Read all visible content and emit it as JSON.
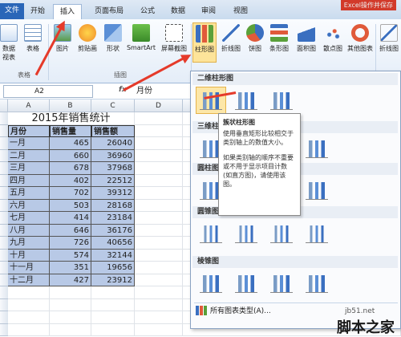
{
  "tabs": [
    {
      "label": "文件"
    },
    {
      "label": "开始"
    },
    {
      "label": "插入"
    },
    {
      "label": "页面布局"
    },
    {
      "label": "公式"
    },
    {
      "label": "数据"
    },
    {
      "label": "审阅"
    },
    {
      "label": "视图"
    }
  ],
  "title_fragment": "Excel操作并保存",
  "ribbon": {
    "groups": {
      "tables": "表格",
      "illustrations": "插图"
    },
    "buttons": {
      "pivot": "数据\n视表",
      "table": "表格",
      "picture": "图片",
      "clipart": "剪贴画",
      "shapes": "形状",
      "smartart": "SmartArt",
      "screenshot": "屏幕截图",
      "column": "柱形图",
      "line": "折线图",
      "pie": "饼图",
      "bar": "条形图",
      "area": "面积图",
      "scatter": "散点图",
      "other": "其他图表",
      "sparkline": "折线图"
    }
  },
  "formula_bar": {
    "name_box": "A2",
    "fx": "fx",
    "value": "月份"
  },
  "sheet": {
    "columns": [
      "A",
      "B",
      "C",
      "D"
    ],
    "title": "2015年销售统计",
    "headers": [
      "月份",
      "销售量",
      "销售额"
    ],
    "rows": [
      [
        "一月",
        "465",
        "26040"
      ],
      [
        "二月",
        "660",
        "36960"
      ],
      [
        "三月",
        "678",
        "37968"
      ],
      [
        "四月",
        "402",
        "22512"
      ],
      [
        "五月",
        "702",
        "39312"
      ],
      [
        "六月",
        "503",
        "28168"
      ],
      [
        "七月",
        "414",
        "23184"
      ],
      [
        "八月",
        "646",
        "36176"
      ],
      [
        "九月",
        "726",
        "40656"
      ],
      [
        "十月",
        "574",
        "32144"
      ],
      [
        "十一月",
        "351",
        "19656"
      ],
      [
        "十二月",
        "427",
        "23912"
      ]
    ]
  },
  "dropdown": {
    "sections": [
      "二维柱形图",
      "三维柱形图",
      "圆柱图",
      "圆锥图",
      "棱锥图"
    ],
    "all_types": "所有图表类型(A)..."
  },
  "tooltip": {
    "title": "簇状柱形图",
    "p1": "使用垂直矩形比较相交于类别轴上的数值大小。",
    "p2": "如果类别轴的顺序不重要或不用于显示项目计数(如直方图)，请使用该图。"
  },
  "watermark": {
    "site": "jb51.net",
    "name": "脚本之家"
  },
  "colors": {
    "accent": "#2a66b8",
    "selection": "#b8c9e6",
    "arrow": "#e53a2a"
  }
}
